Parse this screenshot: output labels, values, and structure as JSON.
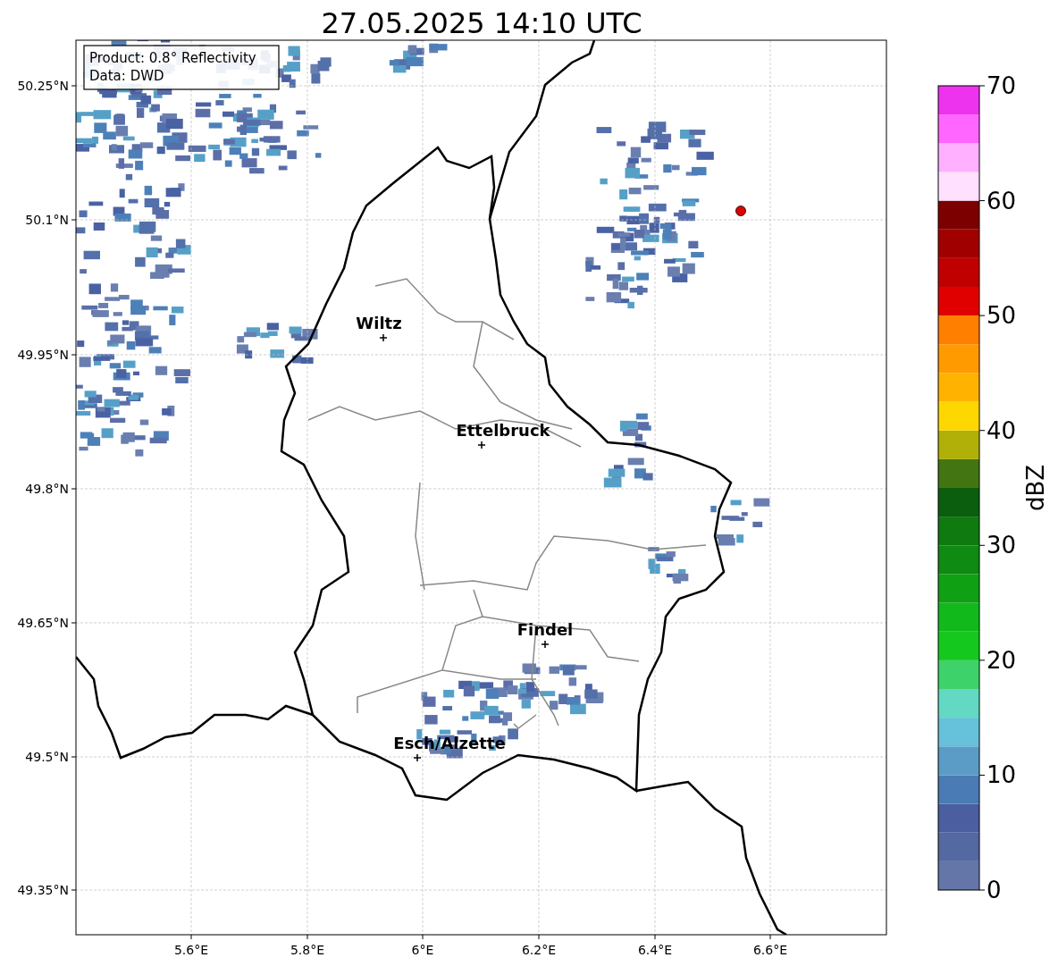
{
  "title": "27.05.2025 14:10 UTC",
  "info_box": [
    "Product: 0.8° Reflectivity",
    "Data: DWD"
  ],
  "x_ticks": [
    "5.6°E",
    "5.8°E",
    "6°E",
    "6.2°E",
    "6.4°E",
    "6.6°E"
  ],
  "y_ticks": [
    "50.25°N",
    "50.1°N",
    "49.95°N",
    "49.8°N",
    "49.65°N",
    "49.5°N",
    "49.35°N"
  ],
  "cities": [
    "Wiltz",
    "Ettelbruck",
    "Findel",
    "Esch/Alzette"
  ],
  "colorbar": {
    "label": "dBZ",
    "ticks": [
      "70",
      "60",
      "50",
      "40",
      "30",
      "20",
      "10",
      "0"
    ],
    "bins": [
      {
        "color": "#6475a8"
      },
      {
        "color": "#5469a2"
      },
      {
        "color": "#4a5ea0"
      },
      {
        "color": "#4a7bb5"
      },
      {
        "color": "#5a9cc6"
      },
      {
        "color": "#66c1da"
      },
      {
        "color": "#63d8c3"
      },
      {
        "color": "#3ed26a"
      },
      {
        "color": "#15c81d"
      },
      {
        "color": "#12b91b"
      },
      {
        "color": "#10a014"
      },
      {
        "color": "#0f8a12"
      },
      {
        "color": "#0e7a10"
      },
      {
        "color": "#0b5e0e"
      },
      {
        "color": "#437513"
      },
      {
        "color": "#b0b008"
      },
      {
        "color": "#ffd700"
      },
      {
        "color": "#ffb300"
      },
      {
        "color": "#ff9a00"
      },
      {
        "color": "#ff7f00"
      },
      {
        "color": "#e00000"
      },
      {
        "color": "#c00000"
      },
      {
        "color": "#a00000"
      },
      {
        "color": "#7d0000"
      },
      {
        "color": "#ffe0ff"
      },
      {
        "color": "#ffb0ff"
      },
      {
        "color": "#ff66ff"
      },
      {
        "color": "#ee33ee"
      }
    ]
  }
}
